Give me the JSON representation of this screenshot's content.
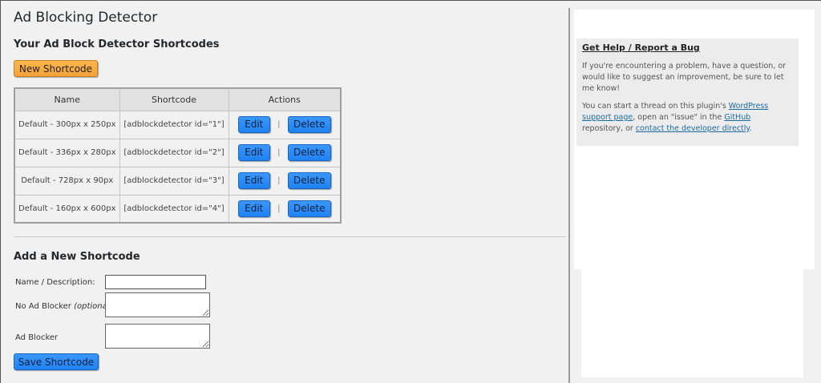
{
  "page": {
    "title": "Ad Blocking Detector",
    "shortcodes_heading": "Your Ad Block Detector Shortcodes",
    "new_shortcode_label": "New Shortcode"
  },
  "table": {
    "headers": [
      "Name",
      "Shortcode",
      "Actions"
    ],
    "rows": [
      {
        "name": "Default - 300px x 250px",
        "shortcode": "[adblockdetector id=\"1\"]",
        "edit": "Edit",
        "sep": "|",
        "delete": "Delete"
      },
      {
        "name": "Default - 336px x 280px",
        "shortcode": "[adblockdetector id=\"2\"]",
        "edit": "Edit",
        "sep": "|",
        "delete": "Delete"
      },
      {
        "name": "Default - 728px x 90px",
        "shortcode": "[adblockdetector id=\"3\"]",
        "edit": "Edit",
        "sep": "|",
        "delete": "Delete"
      },
      {
        "name": "Default - 160px x 600px",
        "shortcode": "[adblockdetector id=\"4\"]",
        "edit": "Edit",
        "sep": "|",
        "delete": "Delete"
      }
    ]
  },
  "form": {
    "heading": "Add a New Shortcode",
    "name_label": "Name / Description:",
    "name_value": "",
    "noadblock_label": "No Ad Blocker",
    "noadblock_optional": "(optional)",
    "noadblock_value": "",
    "adblock_label": "Ad Blocker",
    "adblock_value": "",
    "save_label": "Save Shortcode"
  },
  "help": {
    "title": "Get Help / Report a Bug",
    "para1": "If you're encountering a problem, have a question, or would like to suggest an improvement, be sure to let me know!",
    "para2_a": "You can start a thread on this plugin's ",
    "link_support": "WordPress support page",
    "para2_b": ", open an \"issue\" in the ",
    "link_github": "GitHub",
    "para2_c": " repository, or ",
    "link_contact": "contact the developer directly",
    "para2_d": "."
  },
  "colors": {
    "accent_orange": "#f4a23a",
    "button_blue": "#1f82f2",
    "link": "#1a6aa0",
    "page_bg": "#f1f1f1"
  }
}
